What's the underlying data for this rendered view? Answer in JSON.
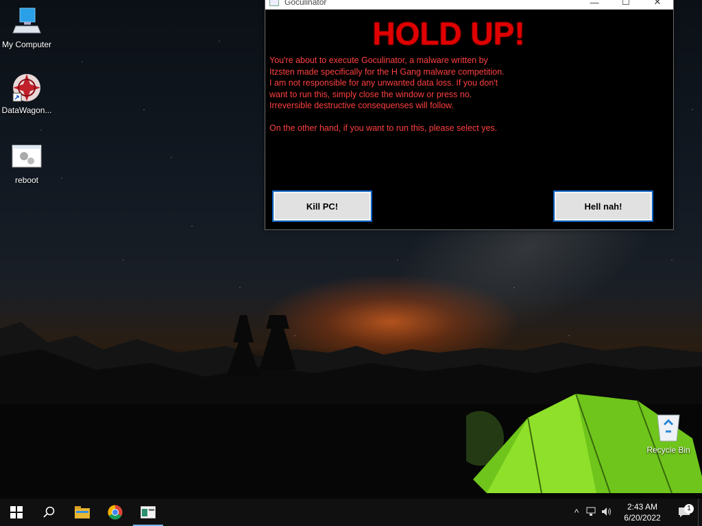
{
  "desktop": {
    "icons": [
      {
        "label": "My Computer",
        "icon": "computer-icon"
      },
      {
        "label": "DataWagon...",
        "icon": "datawagon-shortcut-icon"
      },
      {
        "label": "reboot",
        "icon": "reboot-app-icon"
      },
      {
        "label": "Recycle Bin",
        "icon": "recycle-bin-icon"
      }
    ]
  },
  "window": {
    "title": "Goculinator",
    "controls": {
      "minimize": "—",
      "maximize": "☐",
      "close": "✕"
    },
    "heading": "HOLD UP!",
    "message_lines": [
      "You're about to execute Goculinator, a malware written by",
      "Itzsten made specifically for the H Gang malware competition.",
      "I am not responsible for any unwanted data loss. If you don't",
      "want to run this, simply close the window or press no.",
      "Irreversible destructive consequenses will follow."
    ],
    "message_footer": "On the other hand, if you want to run this, please select yes.",
    "yes_button": "Kill PC!",
    "no_button": "Hell nah!"
  },
  "taskbar": {
    "start_icon": "windows-start-icon",
    "search_icon": "search-icon",
    "apps": [
      "file-explorer-icon",
      "chrome-icon",
      "goculinator-app-icon"
    ],
    "tray": {
      "chevron": "^",
      "time": "2:43 AM",
      "date": "6/20/2022",
      "notification_count": "1"
    }
  },
  "colors": {
    "heading": "#e00000",
    "message": "#ff4040",
    "button_border": "#0a64c8",
    "tent": "#7dd321"
  }
}
